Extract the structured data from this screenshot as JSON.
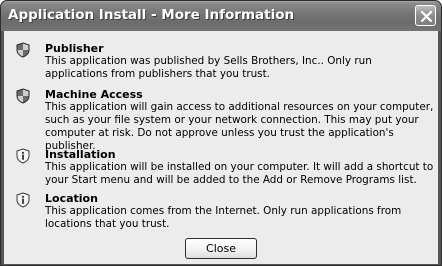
{
  "window": {
    "title": "Application Install - More Information"
  },
  "items": [
    {
      "icon": "shield-icon",
      "title": "Publisher",
      "description": "This application was published by Sells Brothers, Inc.. Only run applications from publishers that you trust."
    },
    {
      "icon": "shield-icon",
      "title": "Machine Access",
      "description": "This application will gain access to additional resources on your computer, such as your file system or your network connection. This may put your computer at risk. Do not approve unless you trust the application's publisher."
    },
    {
      "icon": "info-shield-icon",
      "title": "Installation",
      "description": "This application will be installed on your computer. It will add a shortcut to your Start menu and will be added to the Add or Remove Programs list."
    },
    {
      "icon": "info-shield-icon",
      "title": "Location",
      "description": "This application comes from the Internet. Only run applications from locations that you trust."
    }
  ],
  "buttons": {
    "close_label": "Close"
  }
}
